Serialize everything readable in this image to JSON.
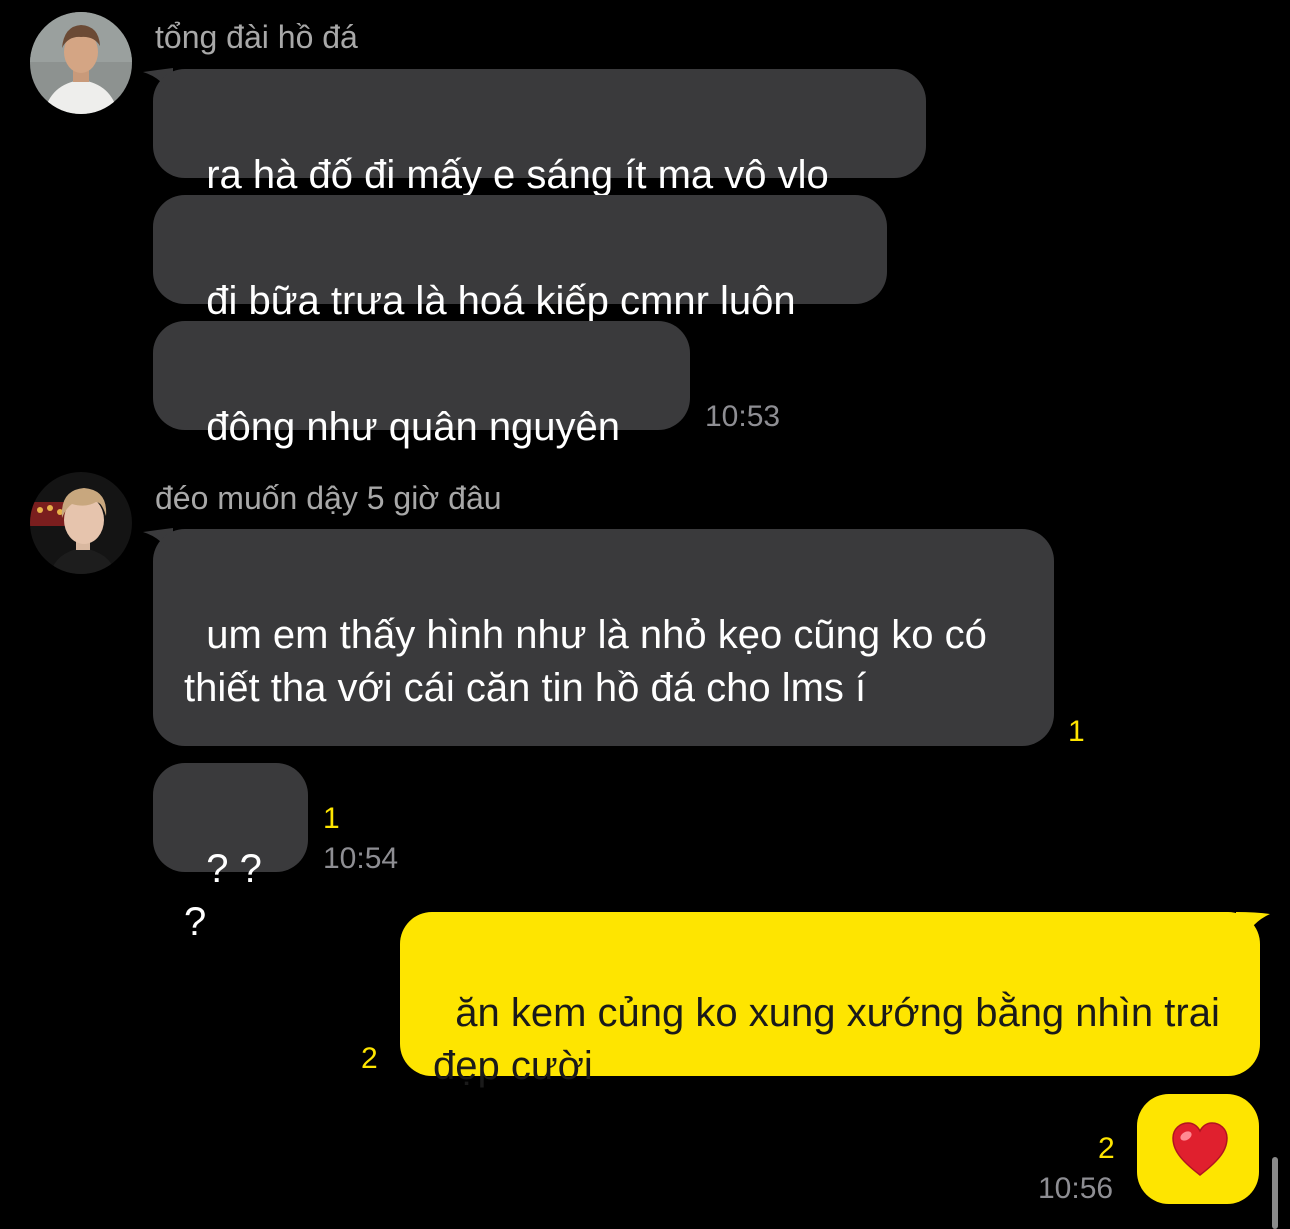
{
  "groups": [
    {
      "sender": "tổng đài hồ đá",
      "messages": [
        {
          "text": "ra hà đố đi mấy e sáng ít ma vô vlo"
        },
        {
          "text": "đi bữa trưa là hoá kiếp cmnr luôn"
        },
        {
          "text": "đông như quân nguyên",
          "time": "10:53"
        }
      ]
    },
    {
      "sender": "đéo muốn dậy 5 giờ đâu",
      "messages": [
        {
          "text": "um em thấy hình như là nhỏ kẹo cũng ko có thiết tha với cái căn tin hồ đá cho lms í",
          "unread": "1"
        },
        {
          "text": "? ? ?",
          "unread": "1",
          "time": "10:54"
        }
      ]
    }
  ],
  "outgoing": [
    {
      "text": "ăn kem củng ko xung xướng bằng nhìn trai đẹp cười",
      "unread": "2"
    },
    {
      "emoji": "heart-emoji",
      "unread": "2",
      "time": "10:56"
    }
  ],
  "colors": {
    "background": "#000000",
    "incoming_bubble": "#3a3a3c",
    "outgoing_bubble": "#fee500",
    "unread_count": "#fee500",
    "timestamp": "#8e8e93",
    "sender_name": "#a8a8a8",
    "heart": "#e0202e"
  }
}
